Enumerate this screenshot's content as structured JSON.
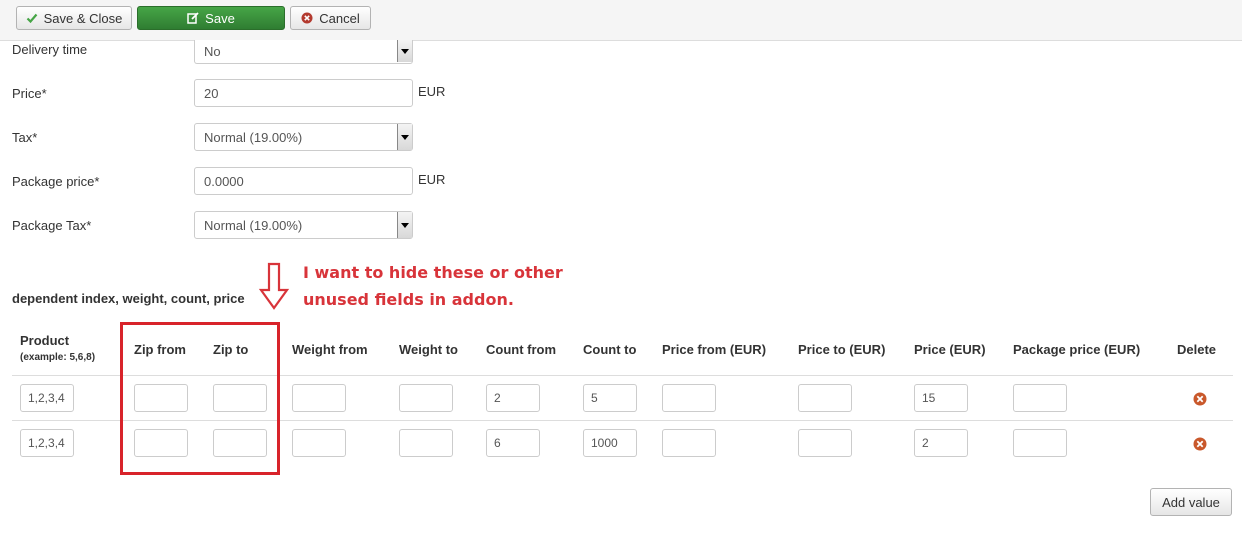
{
  "toolbar": {
    "save_close_label": "Save & Close",
    "save_label": "Save",
    "cancel_label": "Cancel"
  },
  "form": {
    "delivery_time": {
      "label": "Delivery time",
      "value": "No"
    },
    "price": {
      "label": "Price*",
      "value": "20",
      "unit": "EUR"
    },
    "tax": {
      "label": "Tax*",
      "value": "Normal (19.00%)"
    },
    "package_price": {
      "label": "Package price*",
      "value": "0.0000",
      "unit": "EUR"
    },
    "package_tax": {
      "label": "Package Tax*",
      "value": "Normal (19.00%)"
    }
  },
  "section_title": "dependent index, weight, count, price",
  "annotation": {
    "line1": "I want to hide these or other",
    "line2": "unused fields in addon."
  },
  "table": {
    "product_header": "Product",
    "product_example": "(example: 5,6,8)",
    "headers": [
      "Zip from",
      "Zip to",
      "Weight from",
      "Weight to",
      "Count from",
      "Count to",
      "Price from (EUR)",
      "Price to (EUR)",
      "Price (EUR)",
      "Package price (EUR)",
      "Delete"
    ],
    "rows": [
      {
        "product": "1,2,3,4",
        "zip_from": "",
        "zip_to": "",
        "weight_from": "",
        "weight_to": "",
        "count_from": "2",
        "count_to": "5",
        "price_from": "",
        "price_to": "",
        "price": "15",
        "package_price": ""
      },
      {
        "product": "1,2,3,4",
        "zip_from": "",
        "zip_to": "",
        "weight_from": "",
        "weight_to": "",
        "count_from": "6",
        "count_to": "1000",
        "price_from": "",
        "price_to": "",
        "price": "2",
        "package_price": ""
      }
    ]
  },
  "add_value_label": "Add value",
  "colors": {
    "save_green": "#46a546",
    "annotation_red": "#d8343a",
    "delete_icon": "#c9582b"
  }
}
